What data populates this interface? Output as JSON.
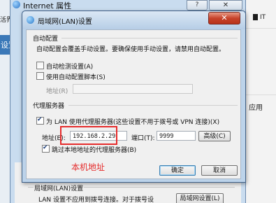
{
  "background": {
    "tab_label": "活界面",
    "settings_label": "设置",
    "right_label": "应用",
    "right_top_label": "IT"
  },
  "outer_window": {
    "title": "Internet 属性",
    "help_label": "?",
    "close_label": "✕",
    "lan_group_title": "局域网(LAN)设置",
    "lan_description": "LAN 设置不应用到拨号连接。对于拨号设",
    "lan_settings_button": "局域网设置(L)"
  },
  "dialog": {
    "title": "局域网(LAN)设置",
    "close_label": "✕",
    "auto_config": {
      "group_title": "自动配置",
      "description": "自动配置会覆盖手动设置。要确保使用手动设置，请禁用自动配置。",
      "auto_detect_label": "自动检测设置(A)",
      "auto_detect_checked": false,
      "use_script_label": "使用自动配置脚本(S)",
      "use_script_checked": false,
      "address_label": "地址(R)",
      "address_value": ""
    },
    "proxy": {
      "group_title": "代理服务器",
      "use_proxy_label": "为 LAN 使用代理服务器(这些设置不用于拨号或 VPN 连接)(X)",
      "use_proxy_checked": true,
      "address_label": "地址(E):",
      "address_value": "192.168.2.29",
      "port_label": "端口(T):",
      "port_value": "9999",
      "advanced_button": "高级(C)",
      "bypass_label": "跳过本地地址的代理服务器(B)",
      "bypass_checked": true
    },
    "ok_button": "确定",
    "cancel_button": "取消"
  },
  "annotation": {
    "caption": "本机地址",
    "color": "#e52b2b"
  }
}
